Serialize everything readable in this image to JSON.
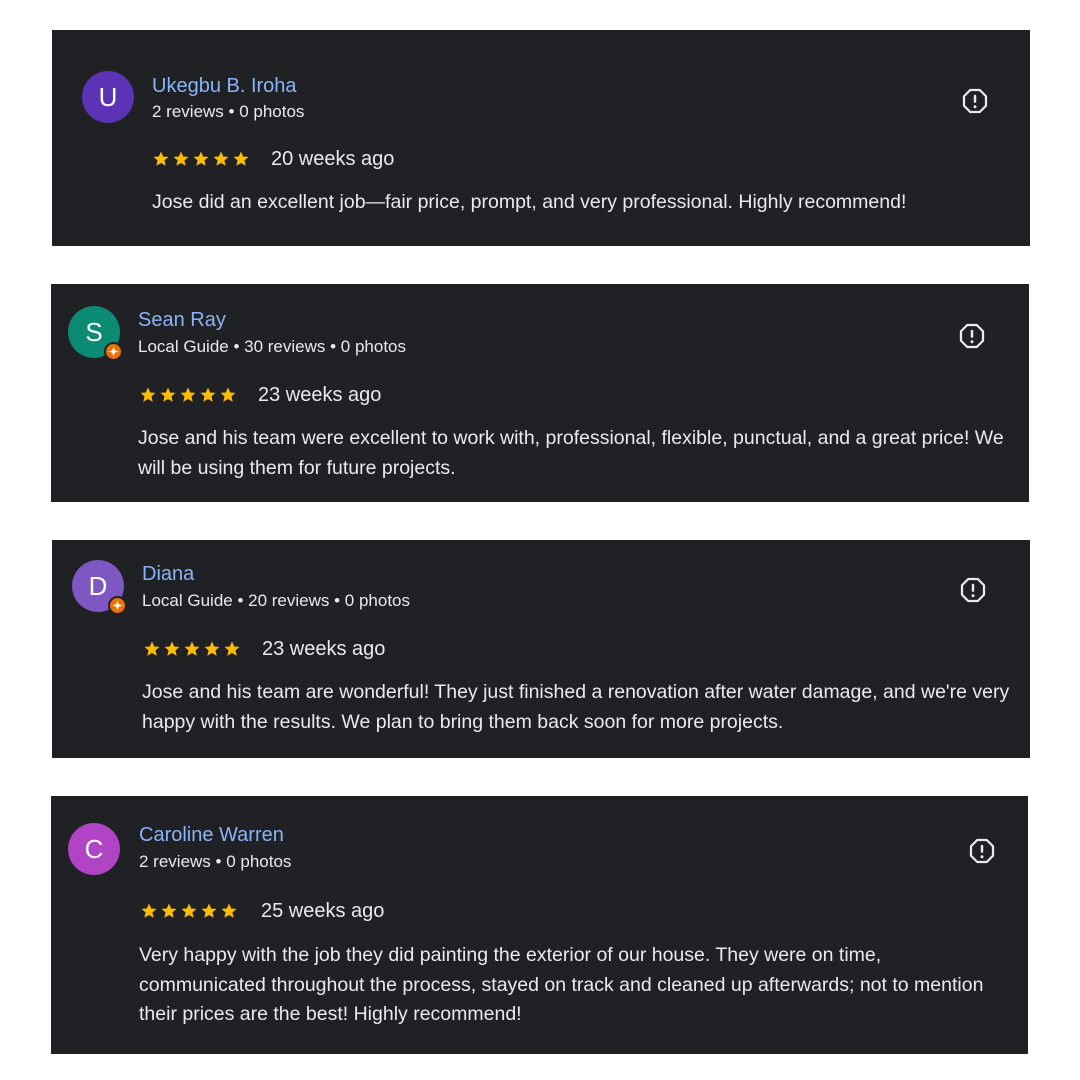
{
  "reviews": [
    {
      "name": "Ukegbu B. Iroha",
      "initial": "U",
      "avatar_color": "#5c33b5",
      "local_guide": false,
      "meta": "2 reviews • 0 photos",
      "rating": 5,
      "date": "20 weeks ago",
      "text": "Jose did an excellent job—fair price, prompt, and very professional. Highly recommend!"
    },
    {
      "name": "Sean Ray",
      "initial": "S",
      "avatar_color": "#0b8a74",
      "local_guide": true,
      "meta": "Local Guide • 30 reviews • 0 photos",
      "rating": 5,
      "date": "23 weeks ago",
      "text": "Jose and his team were excellent to work with, professional, flexible, punctual, and a great price! We will be using them for future projects."
    },
    {
      "name": "Diana",
      "initial": "D",
      "avatar_color": "#7e57c2",
      "local_guide": true,
      "meta": "Local Guide • 20 reviews • 0 photos",
      "rating": 5,
      "date": "23 weeks ago",
      "text": "Jose and his team are wonderful! They just finished a renovation after water damage, and we're very happy with the results. We plan to bring them back soon for more projects."
    },
    {
      "name": "Caroline Warren",
      "initial": "C",
      "avatar_color": "#b044c4",
      "local_guide": false,
      "meta": "2 reviews • 0 photos",
      "rating": 5,
      "date": "25 weeks ago",
      "text": "Very happy with the job they did painting the exterior of our house. They were on time, communicated throughout the process, stayed on track and cleaned up afterwards; not to mention their prices are the best! Highly recommend!"
    }
  ],
  "colors": {
    "card_bg": "#202124",
    "name": "#8ab4f8",
    "text": "#e8eaed",
    "star": "#fbbc04",
    "badge": "#e8710a"
  },
  "icons": {
    "star": "star-icon",
    "flag": "report-flag-icon",
    "badge": "local-guide-badge-icon"
  }
}
